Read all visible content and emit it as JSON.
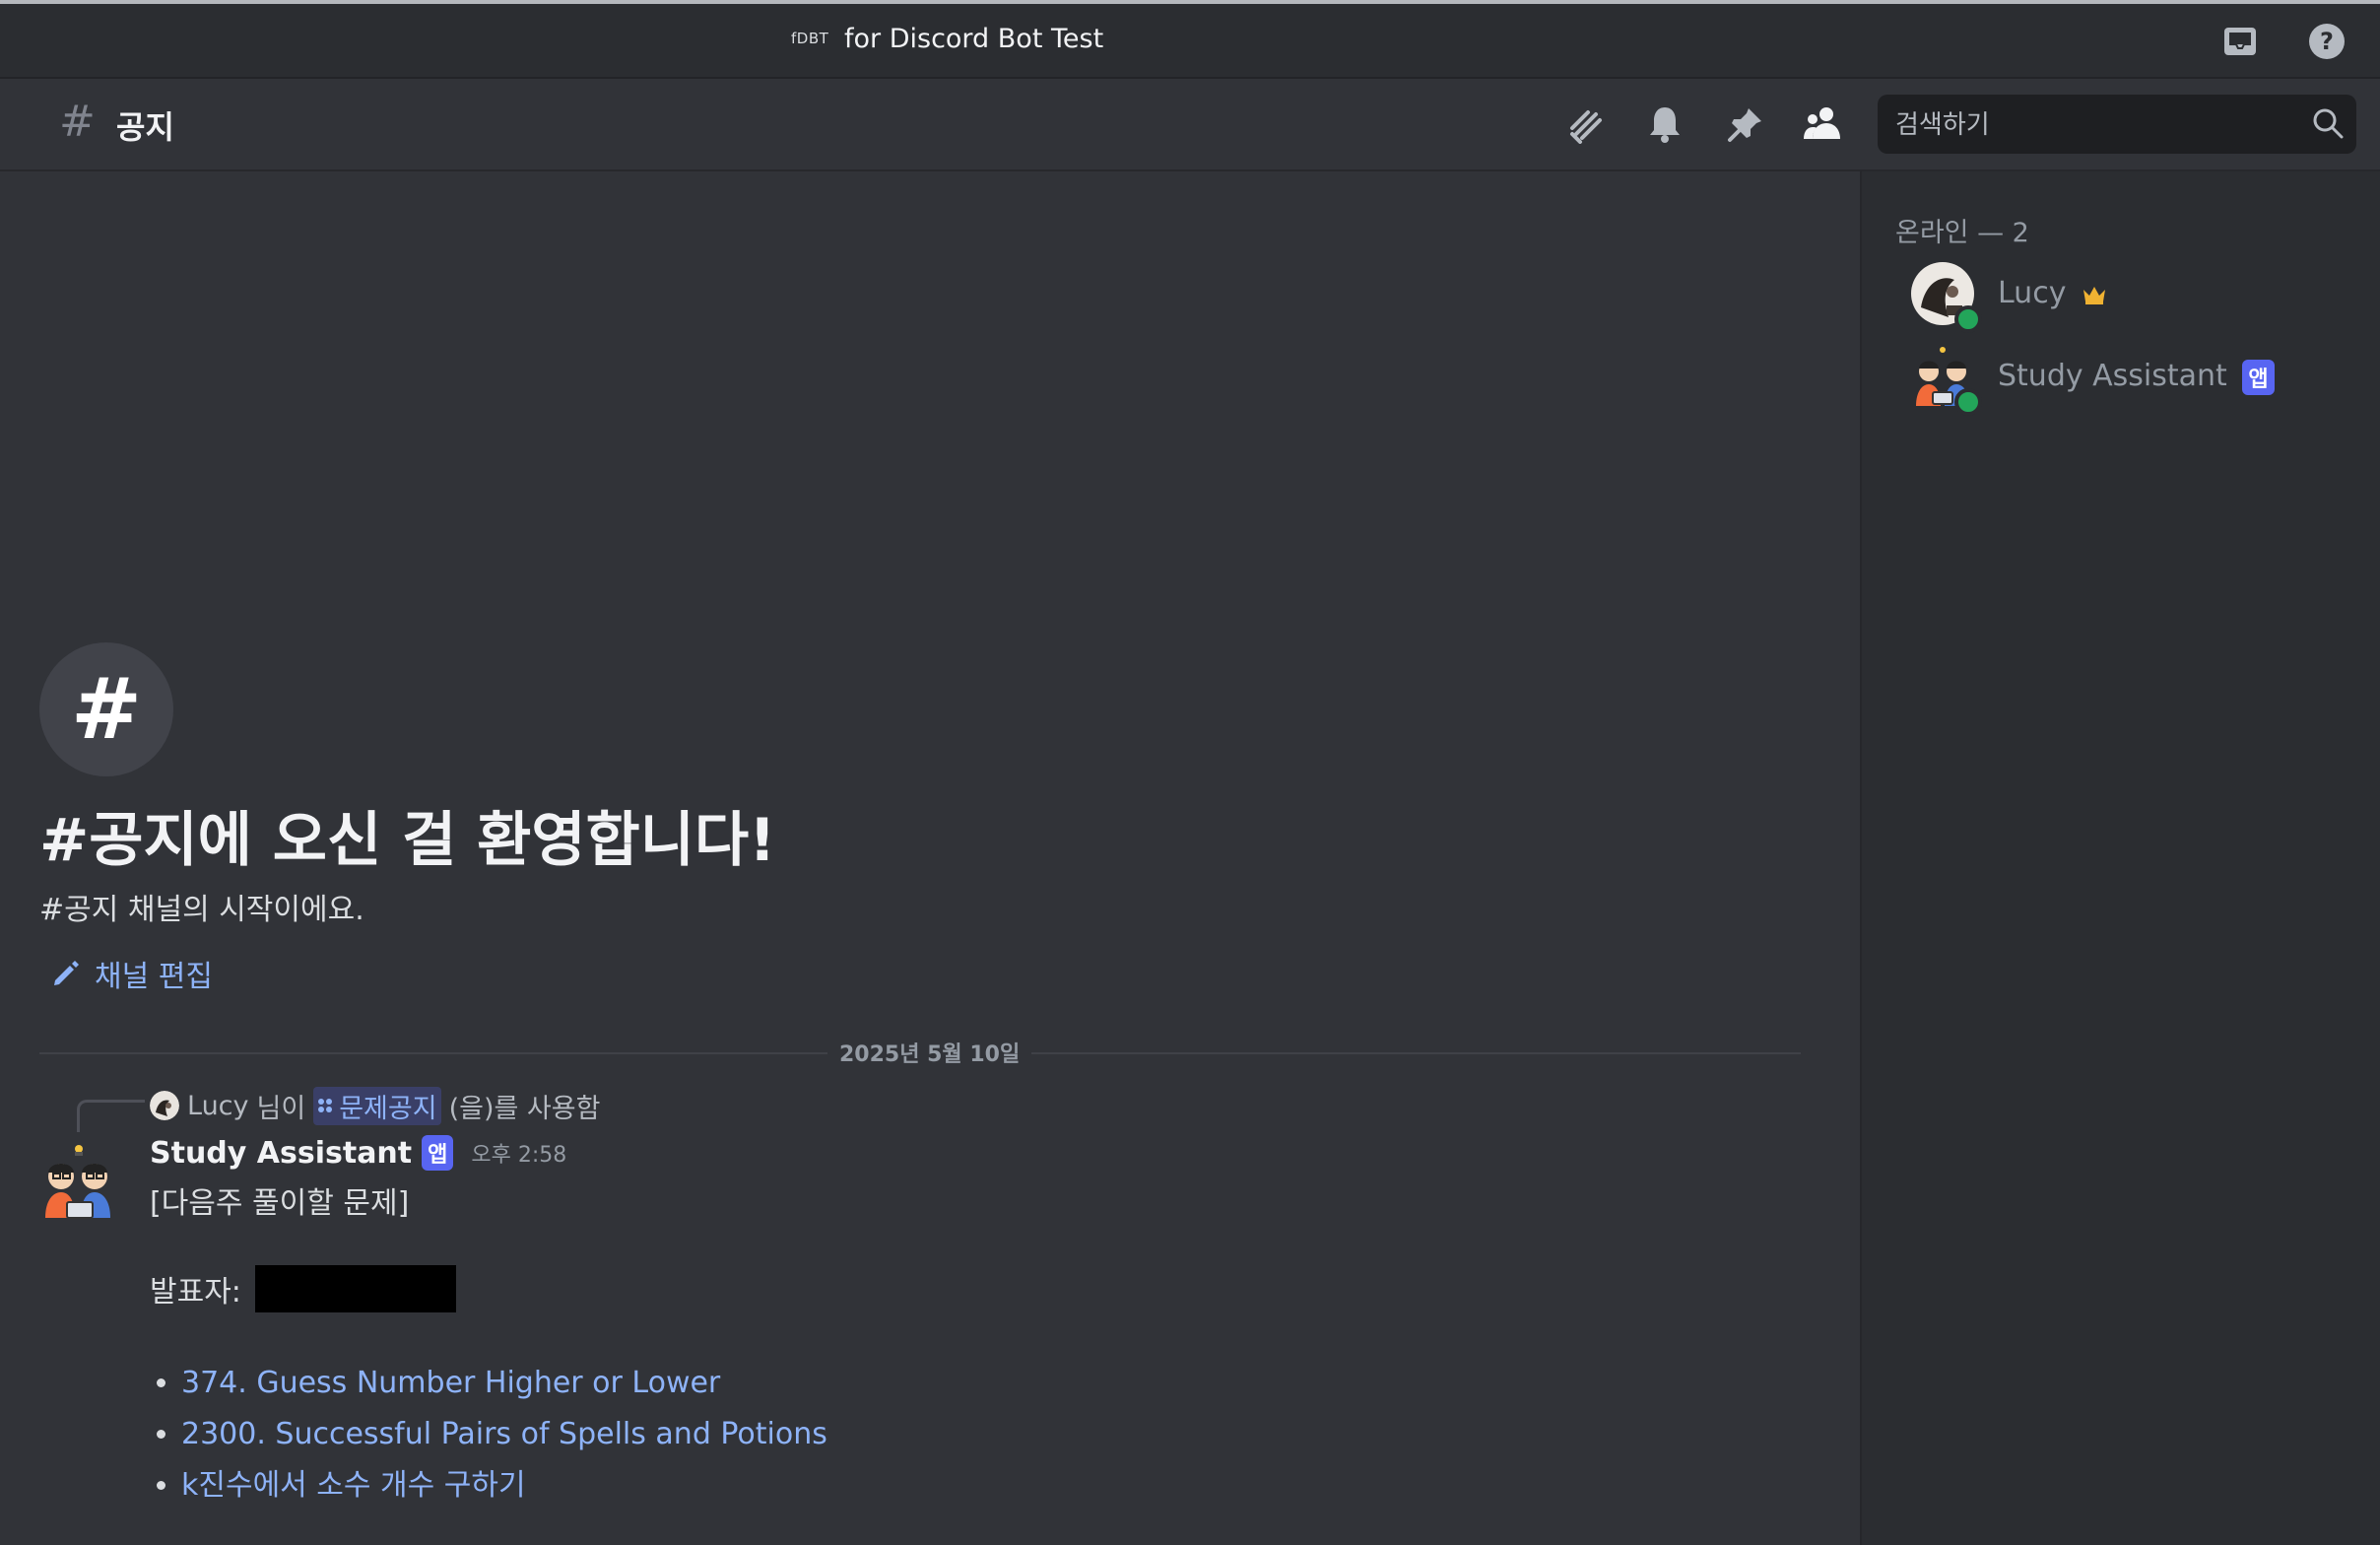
{
  "titlebar": {
    "server_tag": "fDBT",
    "server_name": "for Discord Bot Test",
    "icons": [
      "inbox-icon",
      "help-icon"
    ]
  },
  "header": {
    "hash": "#",
    "channel_name": "공지",
    "icons": [
      "threads-icon",
      "bell-icon",
      "pin-icon",
      "members-icon"
    ],
    "search_placeholder": "검색하기"
  },
  "welcome": {
    "hash": "#",
    "title": "#공지에 오신 걸 환영합니다!",
    "subtitle": "#공지 채널의 시작이에요.",
    "edit_label": "채널 편집"
  },
  "messages": {
    "date_divider": "2025년 5월 10일",
    "reply": {
      "user": "Lucy",
      "prefix": "님이",
      "command": "문제공지",
      "suffix": "(을)를 사용함"
    },
    "author": "Study Assistant",
    "app_badge": "앱",
    "time": "오후 2:58",
    "heading": "[다음주 풀이할 문제]",
    "presenter_label": "발표자:",
    "problems": [
      "374. Guess Number Higher or Lower",
      "2300. Successful Pairs of Spells and Potions",
      "k진수에서 소수 개수 구하기"
    ]
  },
  "members": {
    "section_label": "온라인 — 2",
    "list": [
      {
        "name": "Lucy",
        "badge": "crown-icon"
      },
      {
        "name": "Study Assistant",
        "badge": "앱"
      }
    ]
  },
  "colors": {
    "background": "#313338",
    "sidebar": "#2b2d31",
    "link": "#8eb3f8",
    "online": "#23a55a",
    "app_badge": "#5865f2"
  }
}
